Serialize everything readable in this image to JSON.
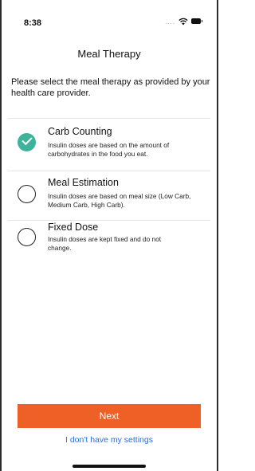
{
  "status_bar": {
    "time": "8:38",
    "signal_dots": "....",
    "wifi_icon": "wifi-icon",
    "battery_icon": "battery-icon"
  },
  "header": {
    "title": "Meal Therapy"
  },
  "intro": "Please select the meal therapy as provided by your health care provider.",
  "options": [
    {
      "title": "Carb Counting",
      "description": "Insulin doses are based on the amount of carbohydrates in the food you eat.",
      "selected": true
    },
    {
      "title": "Meal Estimation",
      "description": "Insulin doses are based on meal size (Low Carb, Medium Carb, High Carb).",
      "selected": false
    },
    {
      "title": "Fixed Dose",
      "description": "Insulin doses are kept fixed and do not change.",
      "selected": false
    }
  ],
  "footer": {
    "next_label": "Next",
    "link_label": "I don't have my settings"
  },
  "colors": {
    "accent": "#ef6026",
    "check": "#3cb39a",
    "link": "#2a6fd6"
  }
}
